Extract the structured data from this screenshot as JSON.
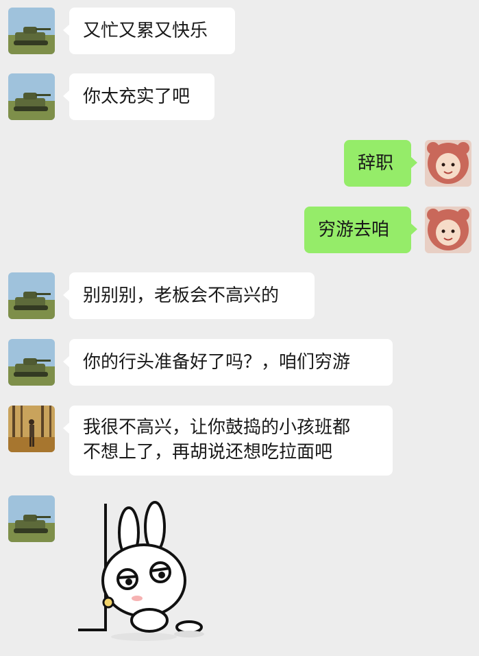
{
  "messages": [
    {
      "side": "in",
      "avatar": "tank-avatar",
      "text": "又忙又累又快乐"
    },
    {
      "side": "in",
      "avatar": "tank-avatar",
      "text": "你太充实了吧"
    },
    {
      "side": "out",
      "avatar": "kid-avatar",
      "text": "辞职"
    },
    {
      "side": "out",
      "avatar": "kid-avatar",
      "text": "穷游去咱"
    },
    {
      "side": "in",
      "avatar": "tank-avatar",
      "text": "别别别，老板会不高兴的"
    },
    {
      "side": "in",
      "avatar": "tank-avatar",
      "text": "你的行头准备好了吗？，咱们穷游"
    },
    {
      "side": "in",
      "avatar": "forest-avatar",
      "lines": [
        "我很不高兴，让你鼓捣的小孩班都",
        "不想上了，再胡说还想吃拉面吧"
      ]
    },
    {
      "side": "in",
      "avatar": "tank-avatar",
      "sticker": "sulking-bunny-sticker"
    }
  ],
  "colors": {
    "background": "#ededed",
    "incoming_bubble": "#ffffff",
    "outgoing_bubble": "#95ec69",
    "text": "#191919"
  }
}
